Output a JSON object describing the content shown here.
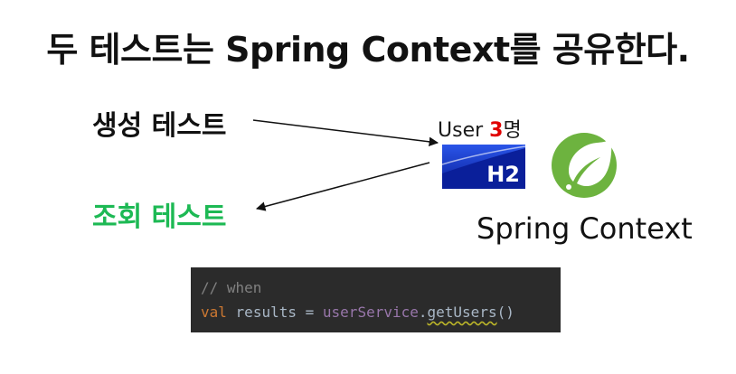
{
  "title": "두 테스트는 Spring Context를 공유한다.",
  "tests": {
    "create": "생성 테스트",
    "query": "조회 테스트"
  },
  "h2": {
    "user_label_prefix": "User ",
    "user_count": "3",
    "user_label_suffix": "명",
    "logo_text": "H2"
  },
  "spring": {
    "label": "Spring Context",
    "logo_icon": "spring-leaf-icon"
  },
  "code": {
    "comment": "// when",
    "keyword": "val",
    "variable": "results",
    "operator": "=",
    "receiver": "userService",
    "dot": ".",
    "method": "getUsers",
    "parens": "()"
  },
  "colors": {
    "query_label": "#1db954",
    "user_count": "#e00000",
    "spring_green": "#6db33f",
    "h2_blue": "#1030c0",
    "code_bg": "#2b2b2b"
  }
}
